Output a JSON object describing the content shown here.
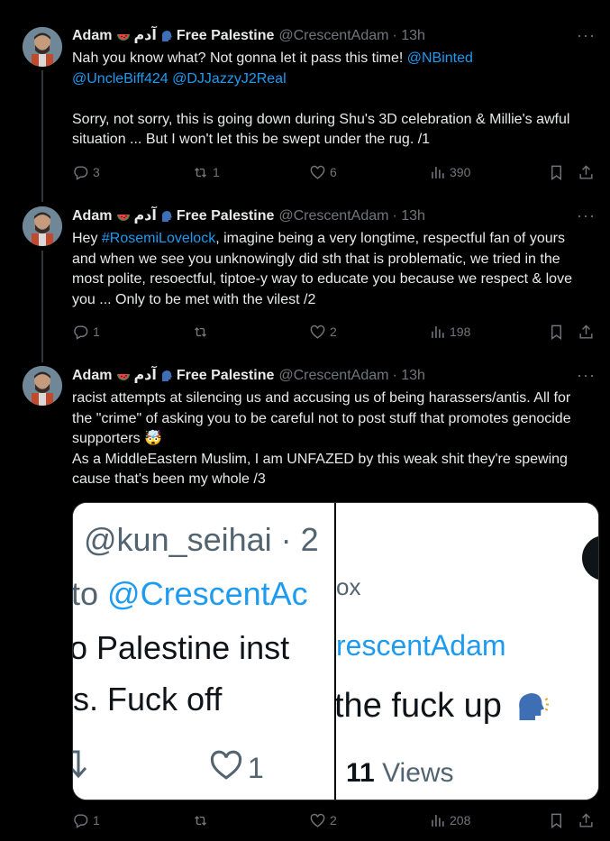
{
  "tweets": [
    {
      "display_name": "Adam",
      "arabic_name": "آدم",
      "suffix": "Free Palestine",
      "handle": "@CrescentAdam",
      "time": "· 13h",
      "mentions_line1_prefix": "Nah you know what? Not gonna let it pass this time! ",
      "mention1": "@NBinted",
      "mention2": "@UncleBiff424",
      "mention3": "@DJJazzyJ2Real",
      "body": "Sorry, not sorry, this is going down during Shu's 3D celebration & Millie's awful situation ... But I won't let this be swept under the rug. /1",
      "replies": "3",
      "reposts": "1",
      "likes": "6",
      "views": "390"
    },
    {
      "display_name": "Adam",
      "arabic_name": "آدم",
      "suffix": "Free Palestine",
      "handle": "@CrescentAdam",
      "time": "· 13h",
      "pre": "Hey ",
      "hashtag": "#RosemiLovelock",
      "body": ", imagine being a very longtime, respectful fan of yours and when we see you unknowingly did sth that is problematic, we tried in the most polite, resoectful, tiptoe-y way to educate you because we respect & love you ... Only to be met with the vilest /2",
      "replies": "1",
      "reposts": "",
      "likes": "2",
      "views": "198"
    },
    {
      "display_name": "Adam",
      "arabic_name": "آدم",
      "suffix": "Free Palestine",
      "handle": "@CrescentAdam",
      "time": "· 13h",
      "body": "racist attempts at silencing us and accusing us of being harassers/antis. All for the \"crime\" of asking you to be careful not to post stuff that promotes genocide supporters 🤯\nAs a MiddleEastern Muslim, I am UNFAZED by this weak shit they're spewing cause that's been my whole /3",
      "replies": "1",
      "reposts": "",
      "likes": "2",
      "views": "208"
    }
  ],
  "media": {
    "left": {
      "line1": "@kun_seihai · 2",
      "line2_prefix": "to ",
      "line2_handle": "@CrescentAc",
      "line3": "o Palestine inst",
      "line4": "s. Fuck off",
      "like_count": "1"
    },
    "right": {
      "line1": "ox",
      "line2": "rescentAdam",
      "line3": "the fuck up",
      "views_num": "11",
      "views_label": "Views"
    }
  },
  "icons": {
    "more": "more-dots-icon",
    "reply": "reply-icon",
    "repost": "repost-icon",
    "like": "heart-icon",
    "views": "views-icon",
    "bookmark": "bookmark-icon",
    "share": "share-icon"
  }
}
